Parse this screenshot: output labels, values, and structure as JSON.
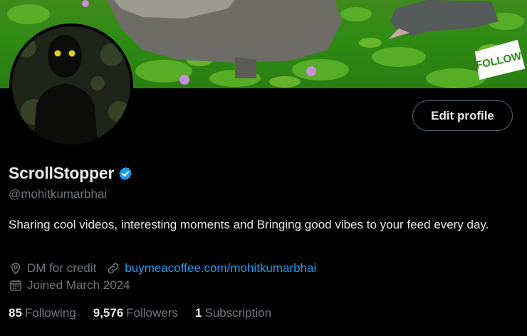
{
  "profile": {
    "display_name": "ScrollStopper",
    "handle": "@mohitkumarbhai",
    "bio": "Sharing cool videos, interesting moments and  Bringing good vibes to your feed every day.",
    "location": "DM for credit",
    "website": "buymeacoffee.com/mohitkumarbhai",
    "joined": "Joined March 2024",
    "verified": true
  },
  "actions": {
    "edit_profile_label": "Edit profile"
  },
  "stats": {
    "following_count": "85",
    "following_label": "Following",
    "followers_count": "9,576",
    "followers_label": "Followers",
    "subscription_count": "1",
    "subscription_label": "Subscription"
  },
  "banner": {
    "sticker_text": "FOLLOW"
  },
  "colors": {
    "background": "#000000",
    "text_primary": "#e7e9ea",
    "text_secondary": "#71767b",
    "link": "#1d9bf0",
    "verified_badge": "#1d9bf0",
    "button_border": "#536471"
  },
  "icons": [
    "location-pin-icon",
    "link-icon",
    "calendar-icon",
    "verified-badge-icon"
  ]
}
